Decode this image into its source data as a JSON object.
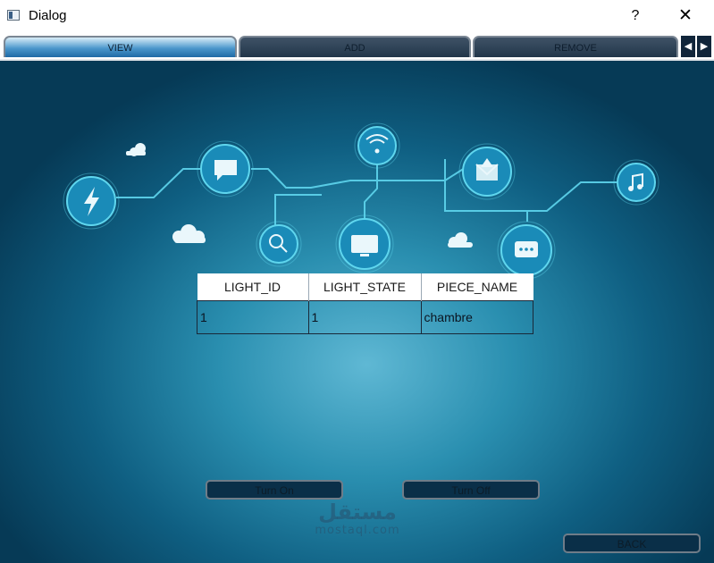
{
  "window": {
    "title": "Dialog",
    "help_label": "?",
    "close_label": "✕"
  },
  "tabs": [
    {
      "label": "VIEW",
      "active": true
    },
    {
      "label": "ADD",
      "active": false
    },
    {
      "label": "REMOVE",
      "active": false
    }
  ],
  "tab_scroll": {
    "left_icon": "◀",
    "right_icon": "▶"
  },
  "table": {
    "columns": [
      "LIGHT_ID",
      "LIGHT_STATE",
      "PIECE_NAME"
    ],
    "rows": [
      [
        "1",
        "1",
        "chambre"
      ]
    ]
  },
  "buttons": {
    "turn_on": "Turn On",
    "turn_off": "Turn Off",
    "back": "BACK"
  },
  "watermark": {
    "arabic": "مستقل",
    "latin": "mostaql.com"
  },
  "colors": {
    "accent": "#1f6aa5",
    "circuit": "#5fd6ee",
    "node_fill": "#1a8bb8",
    "background_dark": "#063a56"
  }
}
